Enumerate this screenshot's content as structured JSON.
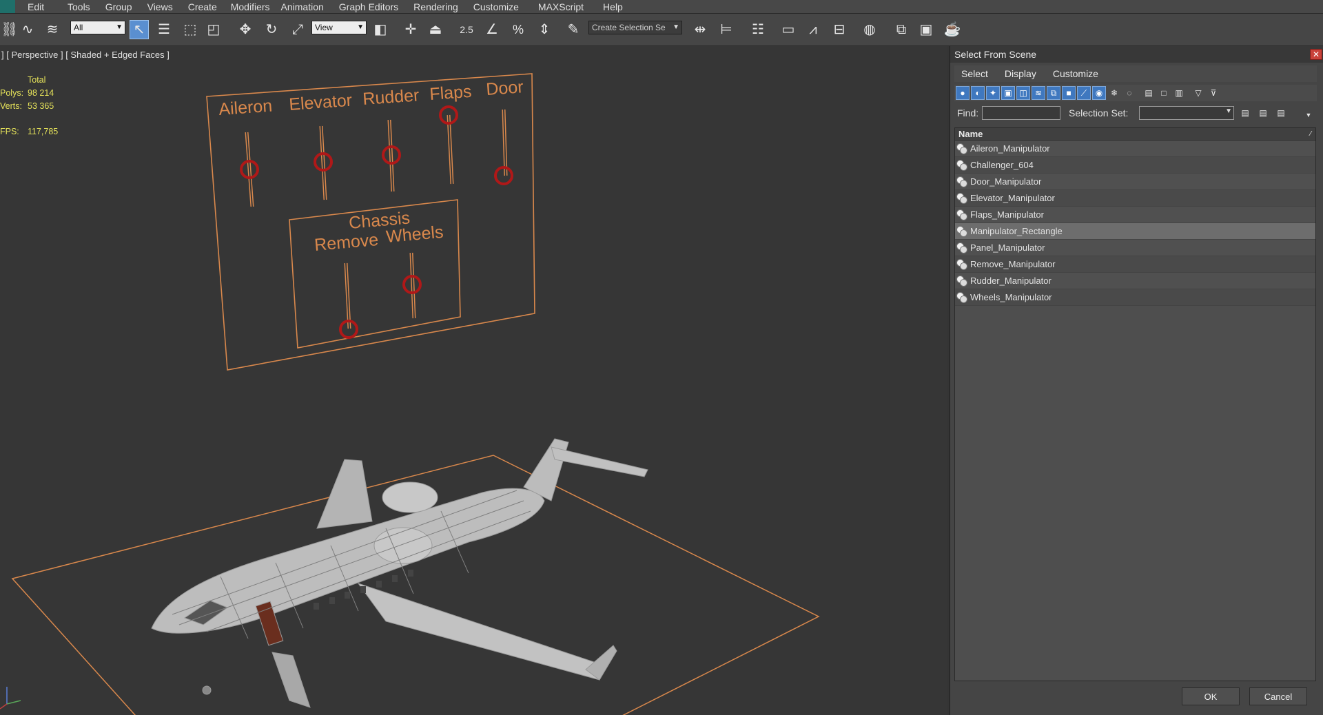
{
  "menubar": {
    "items": [
      "Edit",
      "Tools",
      "Group",
      "Views",
      "Create",
      "Modifiers",
      "Animation",
      "Graph Editors",
      "Rendering",
      "Customize",
      "MAXScript",
      "Help"
    ]
  },
  "toolbar": {
    "filter_select": "All",
    "refcoord_select": "View",
    "snap_angle_label": "2.5",
    "selection_set_placeholder": "Create Selection Se"
  },
  "viewport": {
    "label": "] [ Perspective ] [ Shaded + Edged Faces ]",
    "stats": {
      "header": "Total",
      "rows": [
        {
          "key": "Polys:",
          "value": "98 214"
        },
        {
          "key": "Verts:",
          "value": "53 365"
        },
        {
          "key": "FPS:",
          "value": "117,785"
        }
      ]
    },
    "panel_labels": [
      "Aileron",
      "Elevator",
      "Rudder",
      "Flaps",
      "Door"
    ],
    "chassis_label": "Chassis",
    "sub_labels": [
      "Remove",
      "Wheels"
    ],
    "colors": {
      "accent_orange": "#d9884c",
      "handle_red": "#b01818",
      "wire": "#cfcfcf"
    }
  },
  "dialog": {
    "title": "Select From Scene",
    "close_icon": "close-icon",
    "menu": [
      "Select",
      "Display",
      "Customize"
    ],
    "find_label": "Find:",
    "selection_set_label": "Selection Set:",
    "list_header": "Name",
    "items": [
      {
        "name": "Aileron_Manipulator",
        "highlighted": false
      },
      {
        "name": "Challenger_604",
        "highlighted": false
      },
      {
        "name": "Door_Manipulator",
        "highlighted": false
      },
      {
        "name": "Elevator_Manipulator",
        "highlighted": false
      },
      {
        "name": "Flaps_Manipulator",
        "highlighted": false
      },
      {
        "name": "Manipulator_Rectangle",
        "highlighted": true
      },
      {
        "name": "Panel_Manipulator",
        "highlighted": false
      },
      {
        "name": "Remove_Manipulator",
        "highlighted": false
      },
      {
        "name": "Rudder_Manipulator",
        "highlighted": false
      },
      {
        "name": "Wheels_Manipulator",
        "highlighted": false
      }
    ],
    "ok_label": "OK",
    "cancel_label": "Cancel"
  }
}
